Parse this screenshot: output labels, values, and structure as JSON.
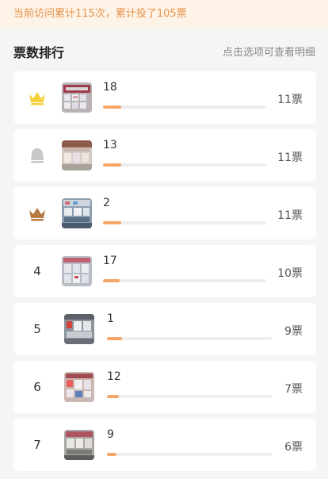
{
  "notice": "当前访问累计115次，累计投了105票",
  "header": {
    "title": "票数排行",
    "hint": "点击选项可查看明细"
  },
  "colors": {
    "accent": "#f6a567",
    "gold": "#f5d23c",
    "silver": "#c8c8c8",
    "bronze": "#b87a45"
  },
  "items": [
    {
      "rank": "1",
      "icon": "gold-crown-icon",
      "name": "18",
      "votes": "11票",
      "progress": 0.11
    },
    {
      "rank": "2",
      "icon": "silver-crown-icon",
      "name": "13",
      "votes": "11票",
      "progress": 0.11
    },
    {
      "rank": "3",
      "icon": "bronze-crown-icon",
      "name": "2",
      "votes": "11票",
      "progress": 0.11
    },
    {
      "rank": "4",
      "icon": "",
      "name": "17",
      "votes": "10票",
      "progress": 0.1
    },
    {
      "rank": "5",
      "icon": "",
      "name": "1",
      "votes": "9票",
      "progress": 0.09
    },
    {
      "rank": "6",
      "icon": "",
      "name": "12",
      "votes": "7票",
      "progress": 0.07
    },
    {
      "rank": "7",
      "icon": "",
      "name": "9",
      "votes": "6票",
      "progress": 0.06
    }
  ]
}
